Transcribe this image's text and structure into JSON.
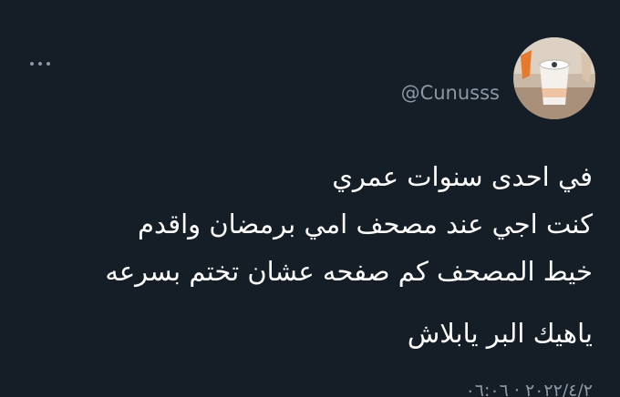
{
  "author": {
    "handle": "@Cunusss"
  },
  "tweet": {
    "lines": [
      "في احدى سنوات عمري",
      "كنت اجي عند مصحف امي برمضان واقدم",
      "خيط المصحف كم صفحه عشان تختم بسرعه"
    ],
    "last_line": "ياهيك البر يابلاش",
    "timestamp": "٢٠٢٢/٤/٢ · ٠٦:٠٦"
  },
  "icons": {
    "more": "more-horizontal-icon",
    "avatar": "avatar-cup-image"
  },
  "colors": {
    "background": "#151d27",
    "text": "#ffffff",
    "secondary": "#8b98a5"
  }
}
